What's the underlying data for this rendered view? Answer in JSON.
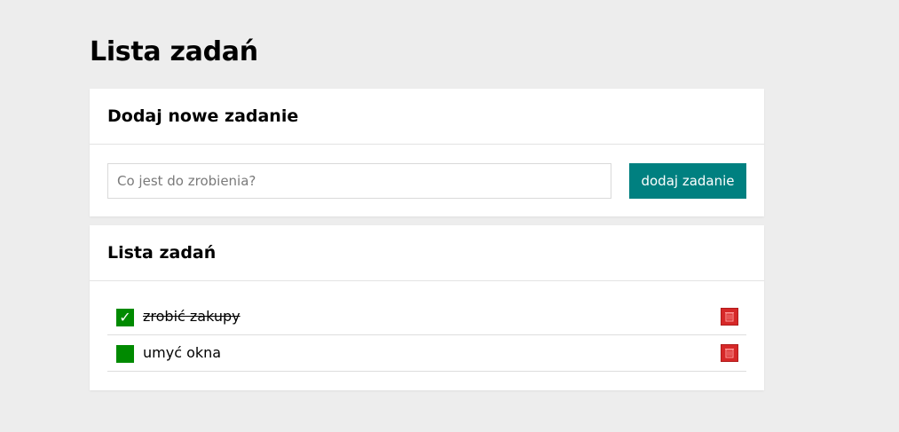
{
  "page": {
    "title": "Lista zadań"
  },
  "add_section": {
    "heading": "Dodaj nowe zadanie",
    "input": {
      "value": "",
      "placeholder": "Co jest do zrobienia?"
    },
    "button_label": "dodaj zadanie"
  },
  "list_section": {
    "heading": "Lista zadań",
    "tasks": [
      {
        "label": "zrobić zakupy",
        "done": true,
        "check_glyph": "✓"
      },
      {
        "label": "umyć okna",
        "done": false,
        "check_glyph": ""
      }
    ]
  },
  "colors": {
    "background": "#ededed",
    "card": "#ffffff",
    "accent_button": "#008080",
    "checkbox": "#008a00",
    "delete": "#d62828"
  },
  "icons": {
    "checkbox": "checkmark-icon",
    "delete": "trash-icon"
  }
}
